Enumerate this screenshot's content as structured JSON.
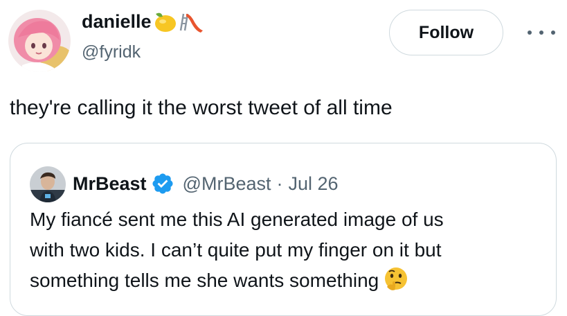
{
  "tweet": {
    "author": {
      "name": "danielle",
      "handle": "@fyridk",
      "name_emojis": [
        "lemon-icon",
        "slide-icon"
      ]
    },
    "follow_label": "Follow",
    "text": "they're calling it the worst tweet of all time",
    "quoted": {
      "name": "MrBeast",
      "verified": true,
      "handle": "@MrBeast",
      "separator": "·",
      "date": "Jul 26",
      "lines": [
        "My fiancé sent me this AI generated image of us",
        "with two kids. I can’t quite put my finger on it but",
        "something tells me she wants something"
      ],
      "trailing_emoji": "thinking-face-icon"
    }
  },
  "colors": {
    "text_primary": "#0f1419",
    "text_secondary": "#536471",
    "border": "#cfd9de",
    "verified_blue": "#1d9bf0"
  }
}
